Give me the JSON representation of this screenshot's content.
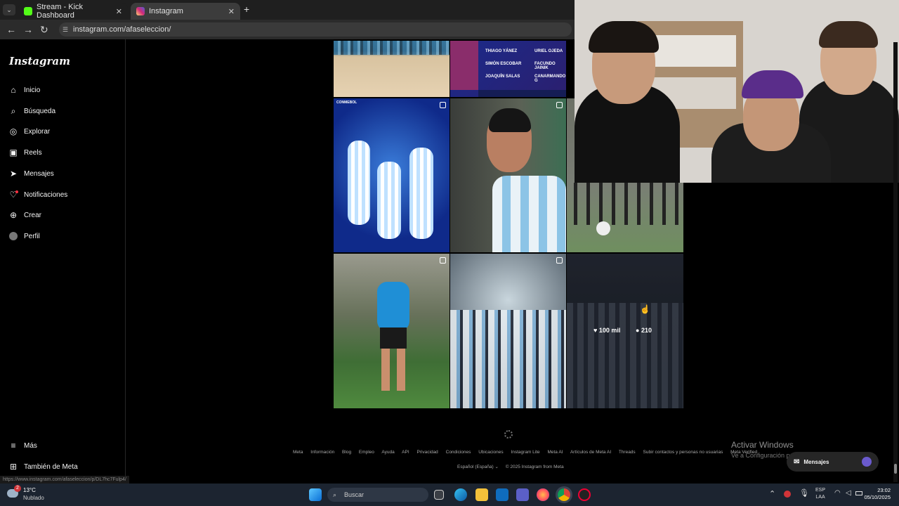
{
  "browser": {
    "tabs": [
      {
        "label": "Stream - Kick Dashboard",
        "color": "#53fc18"
      },
      {
        "label": "Instagram",
        "color": "#e1306c"
      }
    ],
    "new_tab_label": "+",
    "url": "instagram.com/afaseleccion/"
  },
  "instagram": {
    "logo": "Instagram",
    "nav": [
      {
        "label": "Inicio",
        "icon": "home-icon"
      },
      {
        "label": "Búsqueda",
        "icon": "search-icon"
      },
      {
        "label": "Explorar",
        "icon": "compass-icon"
      },
      {
        "label": "Reels",
        "icon": "reels-icon"
      },
      {
        "label": "Mensajes",
        "icon": "send-icon"
      },
      {
        "label": "Notificaciones",
        "icon": "heart-icon"
      },
      {
        "label": "Crear",
        "icon": "plus-square-icon"
      },
      {
        "label": "Perfil",
        "icon": "avatar-icon"
      }
    ],
    "more": "Más",
    "meta": "También de Meta",
    "status_link": "https://www.instagram.com/afaseleccion/p/DL7hc7Fulp4/",
    "posts": {
      "roster_names": [
        "THIAGO YÁNEZ",
        "URIEL OJEDA",
        "SIMÓN ESCOBAR",
        "FACUNDO JAINIK",
        "JOAQUÍN SALAS",
        "CANARMANDO G"
      ],
      "conmebol_label": "CONMEBOL",
      "hover_likes": "100 mil",
      "hover_comments": "210"
    },
    "footer": {
      "links": [
        "Meta",
        "Información",
        "Blog",
        "Empleo",
        "Ayuda",
        "API",
        "Privacidad",
        "Condiciones",
        "Ubicaciones",
        "Instagram Lite",
        "Meta AI",
        "Artículos de Meta AI",
        "Threads",
        "Subir contactos y personas no usuarias",
        "Meta Verified"
      ],
      "language": "Español (España)",
      "copyright": "© 2025 Instagram from Meta"
    },
    "messages_button": "Mensajes"
  },
  "windows": {
    "activate_title": "Activar Windows",
    "activate_sub": "Ve a Configuración para activar Windows.",
    "weather_temp": "13°C",
    "weather_desc": "Nublado",
    "weather_badge": "2",
    "search_placeholder": "Buscar",
    "lang_top": "ESP",
    "lang_bottom": "LAA",
    "time": "23:02",
    "date": "05/10/2025"
  }
}
